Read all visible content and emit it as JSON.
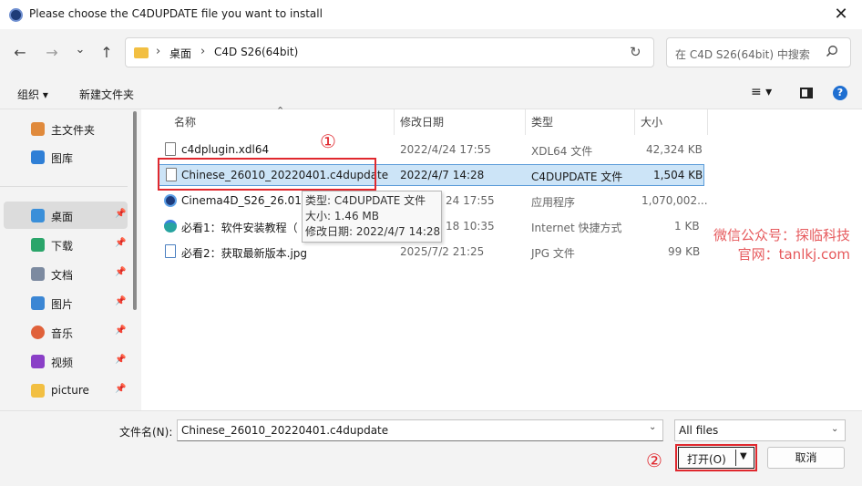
{
  "window": {
    "title": "Please choose the C4DUPDATE file you want to install",
    "close_glyph": "✕"
  },
  "nav": {
    "back_glyph": "←",
    "forward_glyph": "→",
    "dropdown_glyph": "⌄",
    "up_glyph": "↑",
    "breadcrumb": [
      "桌面",
      "C4D S26(64bit)"
    ],
    "crumb_sep": "›",
    "refresh_glyph": "↻",
    "search_placeholder": "在 C4D S26(64bit) 中搜索"
  },
  "toolbar": {
    "organize": "组织 ▾",
    "new_folder": "新建文件夹",
    "view_glyph": "≡ ▾",
    "help_glyph": "?"
  },
  "sidebar": {
    "items": [
      {
        "label": "主文件夹",
        "pinned": false,
        "icon": "home-icon"
      },
      {
        "label": "图库",
        "pinned": false,
        "icon": "gallery-icon"
      },
      {
        "label": "桌面",
        "pinned": true,
        "icon": "desktop-icon"
      },
      {
        "label": "下载",
        "pinned": true,
        "icon": "download-icon"
      },
      {
        "label": "文档",
        "pinned": true,
        "icon": "document-icon"
      },
      {
        "label": "图片",
        "pinned": true,
        "icon": "pictures-icon"
      },
      {
        "label": "音乐",
        "pinned": true,
        "icon": "music-icon"
      },
      {
        "label": "视频",
        "pinned": true,
        "icon": "video-icon"
      },
      {
        "label": "picture",
        "pinned": true,
        "icon": "folder-icon"
      }
    ],
    "pin_glyph": "📌"
  },
  "columns": {
    "name": "名称",
    "modified": "修改日期",
    "type": "类型",
    "size": "大小",
    "sort_glyph": "⌃"
  },
  "files": [
    {
      "name": "c4dplugin.xdl64",
      "modified": "2022/4/24 17:55",
      "type": "XDL64 文件",
      "size": "42,324 KB",
      "icon": "file-icon"
    },
    {
      "name": "Chinese_26010_20220401.c4dupdate",
      "modified": "2022/4/7 14:28",
      "type": "C4DUPDATE 文件",
      "size": "1,504 KB",
      "icon": "file-icon"
    },
    {
      "name": "Cinema4D_S26_26.013",
      "modified": "24 17:55",
      "type": "应用程序",
      "size": "1,070,002...",
      "icon": "cinema4d-icon"
    },
    {
      "name": "必看1：软件安装教程（",
      "modified": "18 10:35",
      "type": "Internet 快捷方式",
      "size": "1 KB",
      "icon": "edge-icon"
    },
    {
      "name": "必看2：获取最新版本.jpg",
      "modified": "2025/7/2 21:25",
      "type": "JPG 文件",
      "size": "99 KB",
      "icon": "image-file-icon"
    }
  ],
  "tooltip": {
    "type_line": "类型: C4DUPDATE 文件",
    "size_line": "大小: 1.46 MB",
    "date_line": "修改日期: 2022/4/7 14:28"
  },
  "annotations": {
    "step1": "①",
    "step2": "②",
    "watermark_line1": "微信公众号：探临科技",
    "watermark_line2": "官网：tanlkj.com"
  },
  "bottom": {
    "filename_label": "文件名(N):",
    "filename_value": "Chinese_26010_20220401.c4dupdate",
    "filetype_value": "All files",
    "chevron_glyph": "⌄",
    "open_label": "打开(O)",
    "open_arrow": "▼",
    "cancel_label": "取消"
  },
  "colors": {
    "accent_red": "#e0282e",
    "selection_blue": "#cce4f7",
    "watermark": "#e6595c"
  }
}
